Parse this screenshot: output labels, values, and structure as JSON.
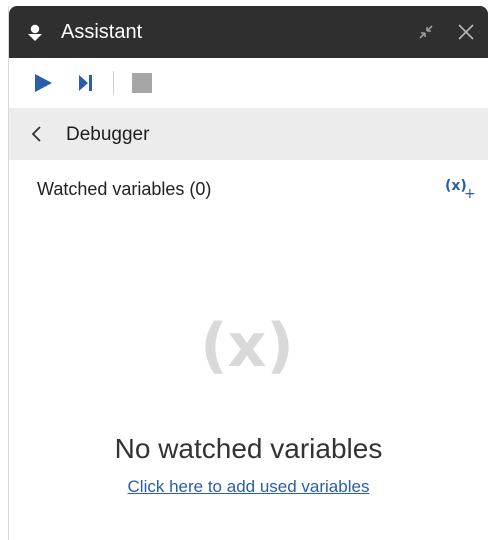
{
  "window": {
    "title": "Assistant",
    "icon": "assistant-icon",
    "controls": [
      "shrink-icon",
      "close-icon"
    ]
  },
  "toolbar": {
    "tools": [
      "play-icon",
      "step-icon",
      "stop-icon"
    ]
  },
  "breadcrumb": {
    "back_icon": "chevron-left-icon",
    "label": "Debugger"
  },
  "watch": {
    "section_title": "Watched variables (0)",
    "add_button_text": "(x)",
    "add_button_plus": "+",
    "empty_icon_text": "(x)",
    "empty_title": "No watched variables",
    "empty_link": "Click here to add used variables"
  },
  "colors": {
    "titlebar": "#2f2f2f",
    "accent": "#2a5ea8",
    "breadcrumb_bg": "#ececec",
    "disabled": "#a6a6a6"
  }
}
